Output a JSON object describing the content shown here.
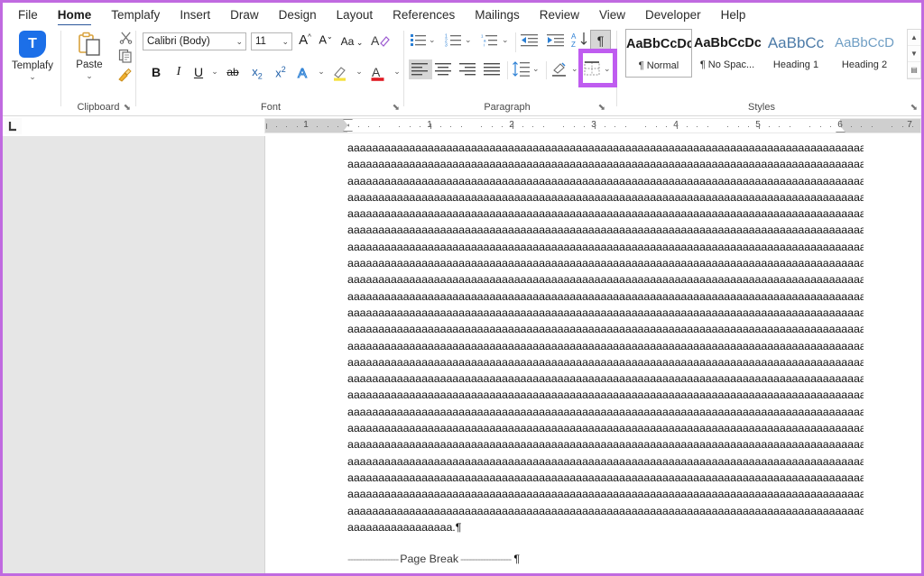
{
  "app": {
    "name": "Microsoft Word",
    "accent_color": "#2b579a",
    "highlight_color": "#bf5cf0",
    "workspace_bg": "#e6e6e6"
  },
  "ribbon": {
    "tabs": [
      {
        "label": "File",
        "active": false
      },
      {
        "label": "Home",
        "active": true
      },
      {
        "label": "Templafy",
        "active": false
      },
      {
        "label": "Insert",
        "active": false
      },
      {
        "label": "Draw",
        "active": false
      },
      {
        "label": "Design",
        "active": false
      },
      {
        "label": "Layout",
        "active": false
      },
      {
        "label": "References",
        "active": false
      },
      {
        "label": "Mailings",
        "active": false
      },
      {
        "label": "Review",
        "active": false
      },
      {
        "label": "View",
        "active": false
      },
      {
        "label": "Developer",
        "active": false
      },
      {
        "label": "Help",
        "active": false
      }
    ],
    "groups": {
      "templafy": {
        "label": "Templafy",
        "button_label": "Templafy",
        "logo_letter": "T",
        "logo_color": "#1c6fe8"
      },
      "clipboard": {
        "label": "Clipboard",
        "paste_label": "Paste",
        "dialog_launcher": "⬊",
        "icons": [
          "paste-icon",
          "cut-scissors-icon",
          "copy-icon",
          "format-painter-icon"
        ]
      },
      "font": {
        "label": "Font",
        "font_name_value": "Calibri (Body)",
        "font_size_value": "11",
        "dialog_launcher": "⬊",
        "buttons": [
          "grow-font-icon",
          "shrink-font-icon",
          "change-case-icon",
          "clear-formatting-icon",
          "bold-icon",
          "italic-icon",
          "underline-icon",
          "strikethrough-icon",
          "subscript-icon",
          "superscript-icon",
          "text-effects-icon",
          "text-highlight-color-icon",
          "font-color-icon"
        ],
        "bold_label": "B",
        "italic_label": "I",
        "underline_label": "U",
        "strikethrough_label": "ab",
        "subscript_label": "x",
        "superscript_label": "x",
        "grow_label": "A",
        "shrink_label": "A",
        "case_label": "Aa"
      },
      "paragraph": {
        "label": "Paragraph",
        "dialog_launcher": "⬊",
        "show_marks_glyph": "¶",
        "show_marks_highlighted": true,
        "buttons": [
          "bullets-icon",
          "numbering-icon",
          "multilevel-list-icon",
          "decrease-indent-icon",
          "increase-indent-icon",
          "sort-icon",
          "show-paragraph-marks-icon",
          "align-left-icon",
          "align-center-icon",
          "align-right-icon",
          "justify-icon",
          "line-spacing-icon",
          "shading-icon",
          "borders-icon"
        ]
      },
      "styles": {
        "label": "Styles",
        "dialog_launcher": "⬊",
        "items": [
          {
            "preview": "AaBbCcDc",
            "name": "¶ Normal",
            "selected": true,
            "heading": false
          },
          {
            "preview": "AaBbCcDc",
            "name": "¶ No Spac...",
            "selected": false,
            "heading": false
          },
          {
            "preview": "AaBbCc",
            "name": "Heading 1",
            "selected": false,
            "heading": true
          },
          {
            "preview": "AaBbCcD",
            "name": "Heading 2",
            "selected": false,
            "heading": true
          }
        ],
        "scroll_up": "▲",
        "scroll_down": "▼",
        "scroll_more": "▤"
      }
    }
  },
  "ruler": {
    "tab_selector_icon": "left-tab-stop-icon",
    "unit": "inch",
    "numbers": [
      "1",
      "1",
      "2",
      "3",
      "4",
      "5",
      "6",
      "7"
    ],
    "left_margin_inches": 1,
    "right_margin_inches": 1,
    "visible_inches": 7.3
  },
  "document": {
    "line_text": "aaaaaaaaaaaaaaaaaaaaaaaaaaaaaaaaaaaaaaaaaaaaaaaaaaaaaaaaaaaaaaaaaaaaaaaaaaaaaaaaaaaaaaaaaa",
    "full_lines": 23,
    "last_line_text": "aaaaaaaaaaaaaaaaa.",
    "paragraph_mark": "¶",
    "page_break_label": "Page Break",
    "page_break_dashes_left": "------------------",
    "page_break_dashes_right": "------------------"
  }
}
